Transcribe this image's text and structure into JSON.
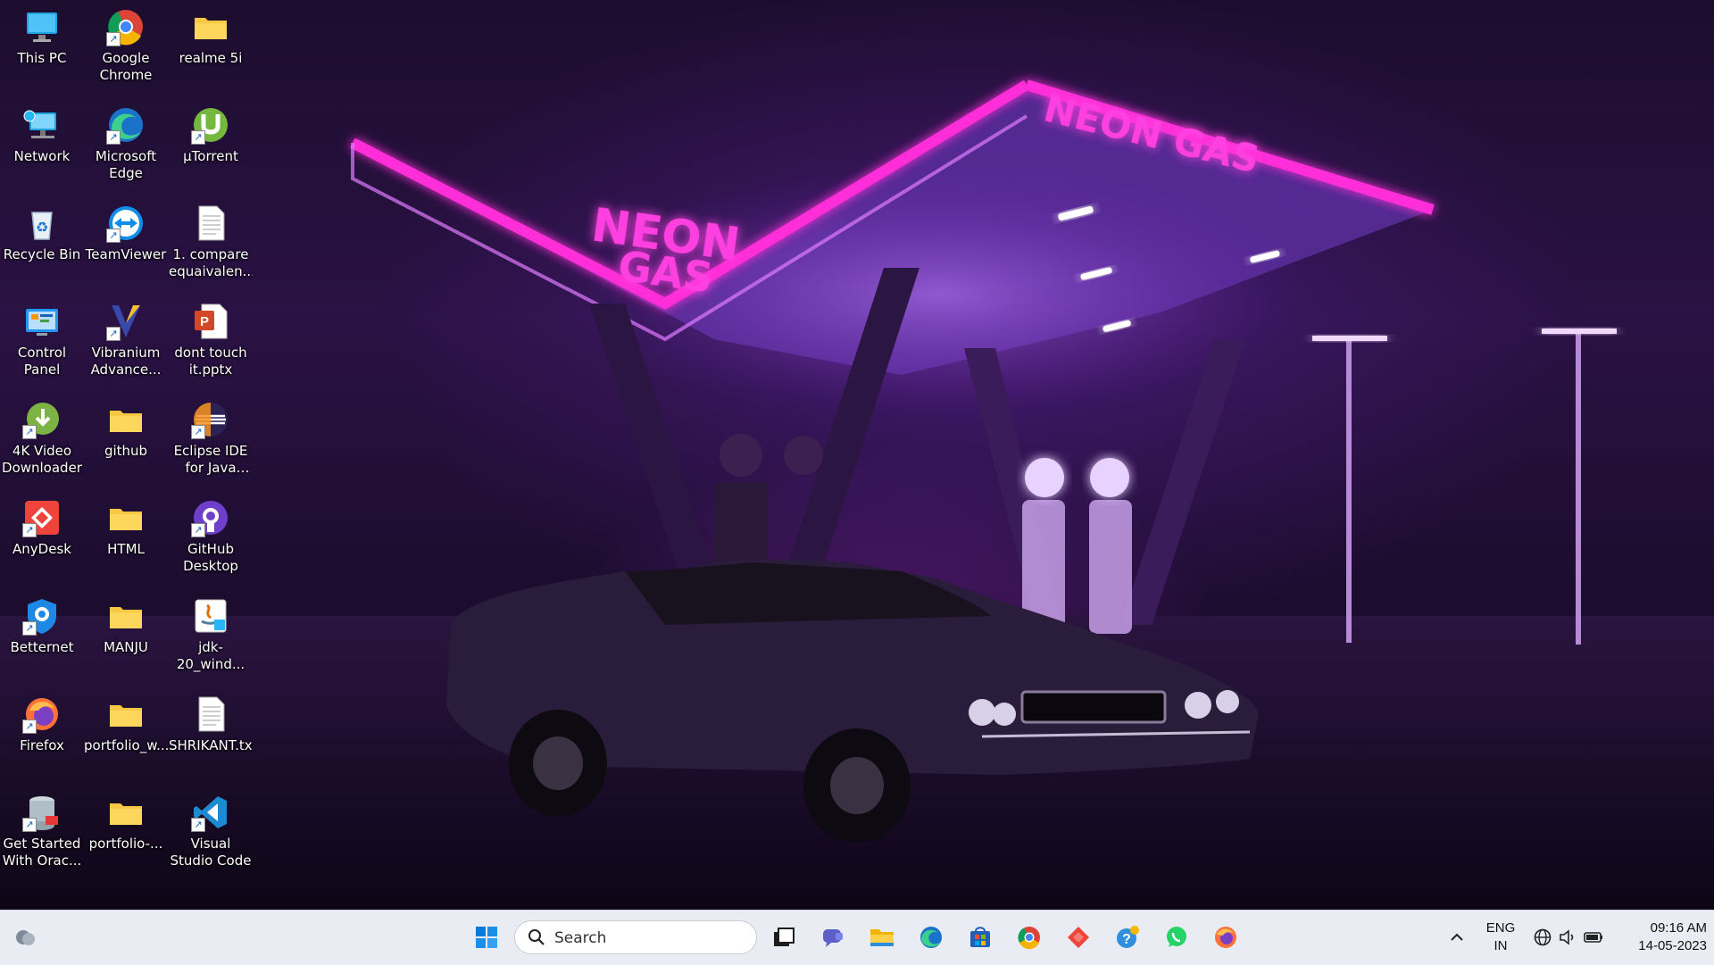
{
  "desktop": {
    "icons": [
      {
        "label": "This PC",
        "icon": "monitor-icon"
      },
      {
        "label": "Google Chrome",
        "icon": "chrome-icon"
      },
      {
        "label": "realme 5i",
        "icon": "folder-icon"
      },
      {
        "label": "Network",
        "icon": "network-icon"
      },
      {
        "label": "Microsoft Edge",
        "icon": "edge-icon"
      },
      {
        "label": "µTorrent",
        "icon": "utorrent-icon"
      },
      {
        "label": "Recycle Bin",
        "icon": "recycle-bin-icon"
      },
      {
        "label": "TeamViewer",
        "icon": "teamviewer-icon"
      },
      {
        "label": "1. compare equaivalen...",
        "icon": "text-file-icon"
      },
      {
        "label": "Control Panel",
        "icon": "control-panel-icon"
      },
      {
        "label": "Vibranium Advance...",
        "icon": "vibranium-icon"
      },
      {
        "label": "dont touch it.pptx",
        "icon": "powerpoint-file-icon"
      },
      {
        "label": "4K Video Downloader",
        "icon": "video-downloader-icon"
      },
      {
        "label": "github",
        "icon": "folder-icon"
      },
      {
        "label": "Eclipse IDE for Java De...",
        "icon": "eclipse-icon"
      },
      {
        "label": "AnyDesk",
        "icon": "anydesk-icon"
      },
      {
        "label": "HTML",
        "icon": "folder-icon"
      },
      {
        "label": "GitHub Desktop",
        "icon": "github-desktop-icon"
      },
      {
        "label": "Betternet",
        "icon": "betternet-icon"
      },
      {
        "label": "MANJU",
        "icon": "folder-icon"
      },
      {
        "label": "jdk-20_wind...",
        "icon": "java-installer-icon"
      },
      {
        "label": "Firefox",
        "icon": "firefox-icon"
      },
      {
        "label": "portfolio_w...",
        "icon": "folder-icon"
      },
      {
        "label": "SHRIKANT.txt",
        "icon": "text-file-icon"
      },
      {
        "label": "Get Started With Orac...",
        "icon": "oracle-database-icon"
      },
      {
        "label": "portfolio-...",
        "icon": "folder-icon"
      },
      {
        "label": "Visual Studio Code",
        "icon": "vscode-icon"
      }
    ]
  },
  "taskbar": {
    "search_placeholder": "Search",
    "pinned": [
      "start-icon",
      "task-view-icon",
      "chat-icon",
      "file-explorer-icon",
      "edge-icon",
      "microsoft-store-icon",
      "chrome-icon",
      "anydesk-icon",
      "get-help-icon",
      "whatsapp-icon",
      "firefox-icon"
    ],
    "tray": {
      "language_line1": "ENG",
      "language_line2": "IN",
      "time": "09:16 AM",
      "date": "14-05-2023"
    }
  },
  "colors": {
    "neon_pink": "#ff2fd8",
    "neon_purple": "#a04bff",
    "taskbar_bg": "#e9edf3"
  }
}
